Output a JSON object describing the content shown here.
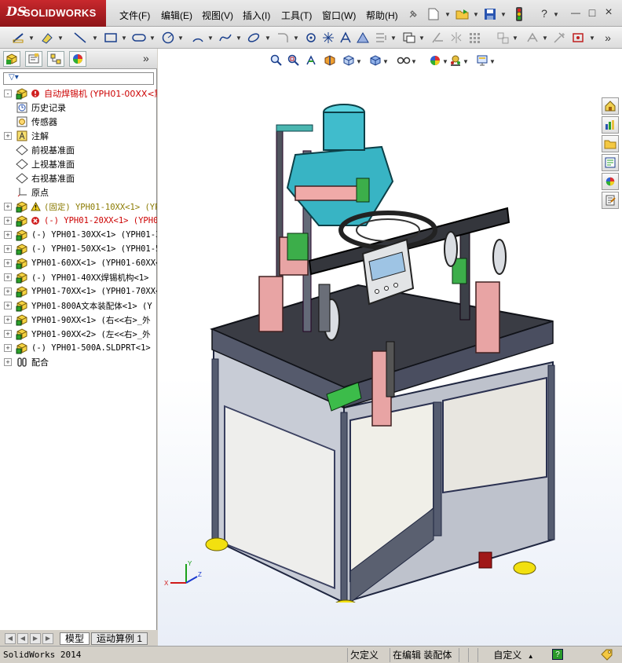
{
  "app": {
    "logo_prefix": "DS",
    "logo_text": "SOLIDWORKS"
  },
  "menu": [
    "文件(F)",
    "编辑(E)",
    "视图(V)",
    "插入(I)",
    "工具(T)",
    "窗口(W)",
    "帮助(H)"
  ],
  "window_controls": {
    "help": "?",
    "minimize": "—",
    "restore": "□",
    "close": "×"
  },
  "toolbar2": {
    "more": "»"
  },
  "feature_manager": {
    "more": "»",
    "filter_icon": "filter-icon",
    "tree": [
      {
        "icon": "assembly-icon",
        "status_icon": "rebuild-error-icon",
        "label": "自动焊锡机  (YPH01-00XX<默",
        "color": "#cc0000",
        "mono": false,
        "expand": "-"
      },
      {
        "icon": "history-icon",
        "label": "历史记录",
        "color": "#000000",
        "expand": ""
      },
      {
        "icon": "sensor-icon",
        "label": "传感器",
        "color": "#000000",
        "expand": ""
      },
      {
        "icon": "annotation-icon",
        "label": "注解",
        "color": "#000000",
        "expand": "+"
      },
      {
        "icon": "plane-icon",
        "label": "前视基准面",
        "color": "#000000",
        "expand": ""
      },
      {
        "icon": "plane-icon",
        "label": "上视基准面",
        "color": "#000000",
        "expand": ""
      },
      {
        "icon": "plane-icon",
        "label": "右视基准面",
        "color": "#000000",
        "expand": ""
      },
      {
        "icon": "origin-icon",
        "label": "原点",
        "color": "#000000",
        "expand": ""
      },
      {
        "icon": "assembly-icon",
        "status_icon": "warning-icon",
        "label": "(固定) YPH01-10XX<1> (YP",
        "color": "#8a7a00",
        "mono": true,
        "expand": "+"
      },
      {
        "icon": "assembly-icon",
        "status_icon": "error-icon",
        "label": "(-) YPH01-20XX<1> (YPH0",
        "color": "#cc0000",
        "mono": true,
        "expand": "+"
      },
      {
        "icon": "assembly-icon",
        "label": "(-) YPH01-30XX<1> (YPH01-3",
        "color": "#000000",
        "mono": true,
        "expand": "+"
      },
      {
        "icon": "assembly-icon",
        "label": "(-) YPH01-50XX<1> (YPH01-5",
        "color": "#000000",
        "mono": true,
        "expand": "+"
      },
      {
        "icon": "assembly-icon",
        "label": "YPH01-60XX<1> (YPH01-60XX<",
        "color": "#000000",
        "mono": true,
        "expand": "+"
      },
      {
        "icon": "assembly-icon",
        "label": "(-) YPH01-40XX焊锡机构<1>",
        "color": "#000000",
        "mono": true,
        "expand": "+"
      },
      {
        "icon": "assembly-icon",
        "label": "YPH01-70XX<1> (YPH01-70XX<",
        "color": "#000000",
        "mono": true,
        "expand": "+"
      },
      {
        "icon": "assembly-icon",
        "label": "YPH01-800A文本装配体<1> (Y",
        "color": "#000000",
        "mono": true,
        "expand": "+"
      },
      {
        "icon": "assembly-icon",
        "label": "YPH01-90XX<1> (右<<右>_外",
        "color": "#000000",
        "mono": true,
        "expand": "+"
      },
      {
        "icon": "assembly-icon",
        "label": "YPH01-90XX<2> (左<<右>_外",
        "color": "#000000",
        "mono": true,
        "expand": "+"
      },
      {
        "icon": "assembly-icon",
        "label": "(-) YPH01-500A.SLDPRT<1>",
        "color": "#000000",
        "mono": true,
        "expand": "+"
      },
      {
        "icon": "mates-icon",
        "label": "配合",
        "color": "#000000",
        "expand": "+"
      }
    ]
  },
  "bottom_tabs": [
    {
      "label": "模型",
      "active": true
    },
    {
      "label": "运动算例 1",
      "active": false
    }
  ],
  "status": {
    "app_name": "SolidWorks 2014",
    "under_defined": "欠定义",
    "editing": "在编辑 装配体",
    "defined": "自定义",
    "help": "?"
  },
  "triad": {
    "x": "X",
    "y": "Y",
    "z": "Z"
  }
}
